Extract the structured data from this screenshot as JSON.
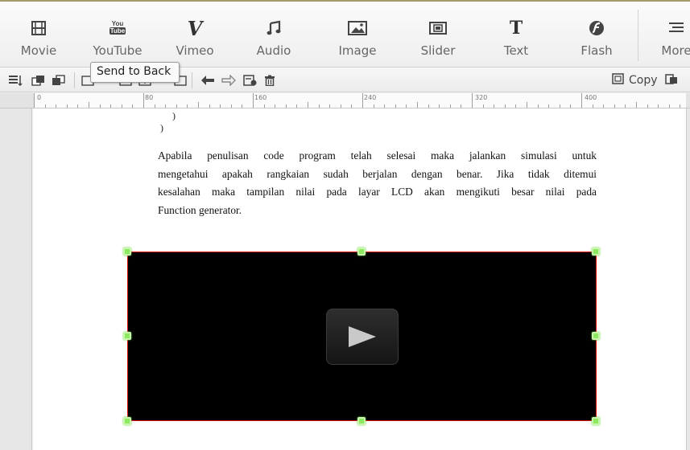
{
  "toolbar": {
    "movie_label": "Movie",
    "youtube_label": "YouTube",
    "vimeo_label": "Vimeo",
    "audio_label": "Audio",
    "image_label": "Image",
    "slider_label": "Slider",
    "text_label": "Text",
    "flash_label": "Flash",
    "more_label": "More",
    "youtube_icon_text": "You Tube"
  },
  "subtoolbar": {
    "copy_label": "Copy",
    "tooltip": "Send to Back"
  },
  "ruler": {
    "marks": [
      "0",
      "80",
      "160",
      "240",
      "320",
      "400"
    ]
  },
  "document": {
    "code_brace_1": ")",
    "code_brace_2": ")",
    "paragraph_lines": [
      "Apabila penulisan code program telah selesai maka jalankan simulasi untuk",
      "mengetahui apakah rangkaian sudah berjalan dengan benar. Jika tidak ditemui",
      "kesalahan maka tampilan nilai pada layar LCD akan mengikuti besar nilai pada",
      "Function generator."
    ]
  },
  "colors": {
    "selection_border": "#dd1111",
    "handle": "#8dea60",
    "video_bg": "#000000"
  }
}
